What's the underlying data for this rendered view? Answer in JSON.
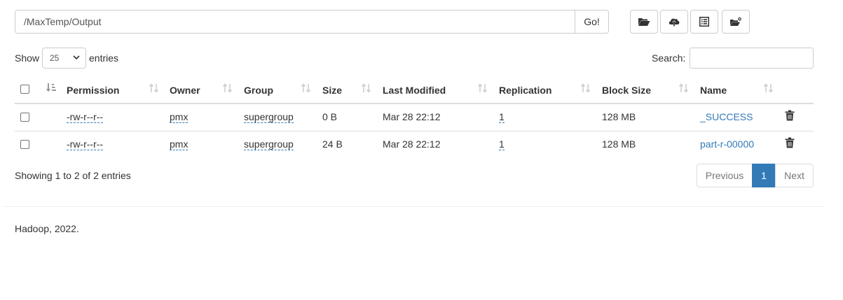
{
  "path": {
    "value": "/MaxTemp/Output",
    "go_label": "Go!"
  },
  "toolbar": {
    "buttons": [
      {
        "icon": "folder-open-icon"
      },
      {
        "icon": "cloud-upload-icon"
      },
      {
        "icon": "list-alt-icon"
      },
      {
        "icon": "shell-icon"
      }
    ]
  },
  "length": {
    "show_label": "Show",
    "selected": "25",
    "entries_label": "entries"
  },
  "search": {
    "label": "Search:",
    "value": ""
  },
  "table": {
    "headers": {
      "permission": "Permission",
      "owner": "Owner",
      "group": "Group",
      "size": "Size",
      "last_modified": "Last Modified",
      "replication": "Replication",
      "block_size": "Block Size",
      "name": "Name"
    },
    "rows": [
      {
        "permission": "-rw-r--r--",
        "owner": "pmx",
        "group": "supergroup",
        "size": "0 B",
        "last_modified": "Mar 28 22:12",
        "replication": "1",
        "block_size": "128 MB",
        "name": "_SUCCESS"
      },
      {
        "permission": "-rw-r--r--",
        "owner": "pmx",
        "group": "supergroup",
        "size": "24 B",
        "last_modified": "Mar 28 22:12",
        "replication": "1",
        "block_size": "128 MB",
        "name": "part-r-00000"
      }
    ]
  },
  "info": "Showing 1 to 2 of 2 entries",
  "pagination": {
    "previous": "Previous",
    "current": "1",
    "next": "Next"
  },
  "footer": "Hadoop, 2022.",
  "colors": {
    "accent": "#337ab7",
    "border": "#dddddd"
  }
}
